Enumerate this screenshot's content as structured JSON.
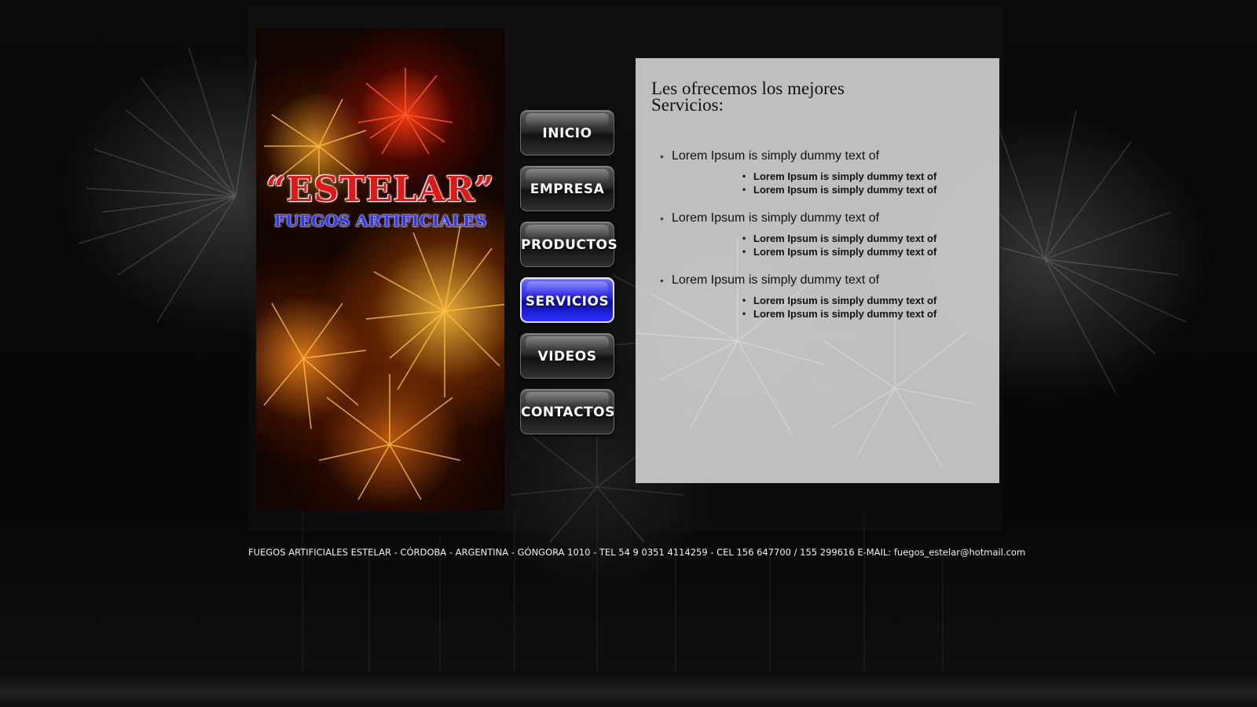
{
  "brand": {
    "title": "“ESTELAR”",
    "subtitle": "FUEGOS ARTIFICIALES"
  },
  "nav": {
    "items": [
      {
        "label": "INICIO",
        "active": false
      },
      {
        "label": "EMPRESA",
        "active": false
      },
      {
        "label": "PRODUCTOS",
        "active": false
      },
      {
        "label": "SERVICIOS",
        "active": true
      },
      {
        "label": "VIDEOS",
        "active": false
      },
      {
        "label": "CONTACTOS",
        "active": false
      }
    ]
  },
  "content": {
    "heading_line1": "Les ofrecemos los mejores",
    "heading_line2": "Servicios:",
    "services": [
      {
        "label": "Lorem Ipsum is simply dummy text of",
        "subitems": [
          "Lorem Ipsum is simply dummy text of",
          "Lorem Ipsum is simply dummy text of"
        ]
      },
      {
        "label": "Lorem Ipsum is simply dummy text of",
        "subitems": [
          "Lorem Ipsum is simply dummy text of",
          "Lorem Ipsum is simply dummy text of"
        ]
      },
      {
        "label": "Lorem Ipsum is simply dummy text of",
        "subitems": [
          "Lorem Ipsum is simply dummy text of",
          "Lorem Ipsum is simply dummy text of"
        ]
      }
    ]
  },
  "footer": {
    "text": "FUEGOS ARTIFICIALES ESTELAR - CÓRDOBA - ARGENTINA - GÓNGORA  1010 - TEL 54 9 0351 4114259 - CEL  156 647700 / 155 299616 E-MAIL: fuegos_estelar@hotmail.com"
  },
  "colors": {
    "brand_red": "#e01818",
    "brand_blue": "#2a36ff",
    "active_nav": "#2323e0",
    "panel_bg": "#d8d8d8"
  }
}
